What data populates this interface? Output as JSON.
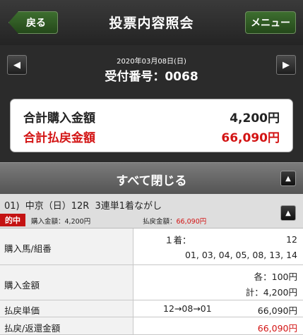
{
  "header": {
    "back_label": "戻る",
    "title": "投票内容照会",
    "menu_label": "メニュー"
  },
  "datebar": {
    "date": "2020年03月08日(日)",
    "receipt_label": "受付番号：0068",
    "prev_icon": "triangle-left-icon",
    "next_icon": "triangle-right-icon"
  },
  "summary": {
    "purchase_label": "合計購入金額",
    "purchase_value": "4,200円",
    "payout_label": "合計払戻金額",
    "payout_value": "66,090円"
  },
  "close_all": {
    "label": "すべて閉じる",
    "icon": "triangle-up-icon"
  },
  "race": {
    "index": "01)",
    "venue": "中京（日）12R",
    "bet_type": "3連単1着ながし",
    "hit_badge": "的中",
    "purchase_text": "購入金額：4,200円",
    "payout_prefix": "払戻金額：",
    "payout_value": "66,090円",
    "icon": "triangle-up-icon"
  },
  "detail": {
    "horses_label": "購入馬/組番",
    "first_label": "１着：",
    "first_value": "12",
    "others_value": "01, 03, 04, 05, 08, 13, 14",
    "amount_label": "購入金額",
    "each_value": "各：100円",
    "total_value": "計：4,200円",
    "unit_label": "払戻単価",
    "unit_combo": "12→08→01",
    "unit_value": "66,090円",
    "refund_label": "払戻/返還金額",
    "refund_value": "66,090円"
  },
  "colors": {
    "accent_green": "#2f5a22",
    "payout_red": "#d31414",
    "hit_red": "#c41212"
  }
}
